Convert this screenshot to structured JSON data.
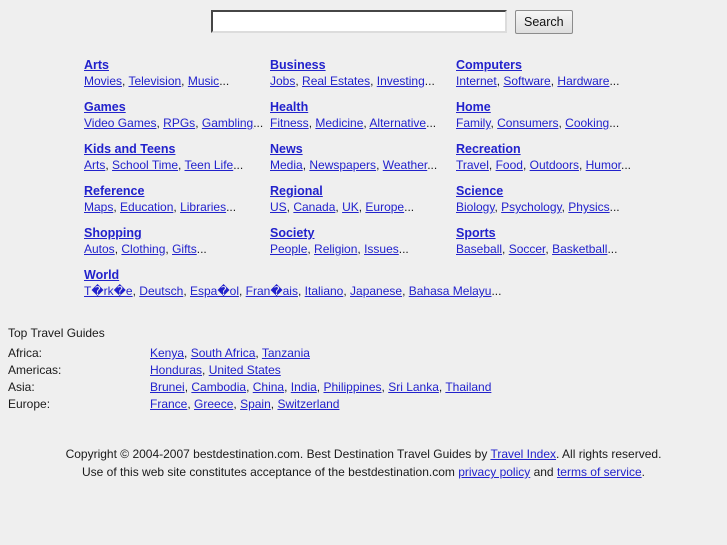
{
  "search": {
    "value": "",
    "placeholder": "",
    "button_label": "Search"
  },
  "categories": [
    {
      "title": "Arts",
      "subs": [
        "Movies",
        "Television",
        "Music"
      ],
      "ellipsis": "..."
    },
    {
      "title": "Business",
      "subs": [
        "Jobs",
        "Real Estates",
        "Investing"
      ],
      "ellipsis": "..."
    },
    {
      "title": "Computers",
      "subs": [
        "Internet",
        "Software",
        "Hardware"
      ],
      "ellipsis": "..."
    },
    {
      "title": "Games",
      "subs": [
        "Video Games",
        "RPGs",
        "Gambling"
      ],
      "ellipsis": "..."
    },
    {
      "title": "Health",
      "subs": [
        "Fitness",
        "Medicine",
        "Alternative"
      ],
      "ellipsis": "..."
    },
    {
      "title": "Home",
      "subs": [
        "Family",
        "Consumers",
        "Cooking"
      ],
      "ellipsis": "..."
    },
    {
      "title": "Kids and Teens",
      "subs": [
        "Arts",
        "School Time",
        "Teen Life"
      ],
      "ellipsis": "..."
    },
    {
      "title": "News",
      "subs": [
        "Media",
        "Newspapers",
        "Weather"
      ],
      "ellipsis": "..."
    },
    {
      "title": "Recreation",
      "subs": [
        "Travel",
        "Food",
        "Outdoors",
        "Humor"
      ],
      "ellipsis": "..."
    },
    {
      "title": "Reference",
      "subs": [
        "Maps",
        "Education",
        "Libraries"
      ],
      "ellipsis": "..."
    },
    {
      "title": "Regional",
      "subs": [
        "US",
        "Canada",
        "UK",
        "Europe"
      ],
      "ellipsis": "..."
    },
    {
      "title": "Science",
      "subs": [
        "Biology",
        "Psychology",
        "Physics"
      ],
      "ellipsis": "..."
    },
    {
      "title": "Shopping",
      "subs": [
        "Autos",
        "Clothing",
        "Gifts"
      ],
      "ellipsis": "..."
    },
    {
      "title": "Society",
      "subs": [
        "People",
        "Religion",
        "Issues"
      ],
      "ellipsis": "..."
    },
    {
      "title": "Sports",
      "subs": [
        "Baseball",
        "Soccer",
        "Basketball"
      ],
      "ellipsis": "..."
    },
    {
      "title": "World",
      "subs": [
        "T�rk�e",
        "Deutsch",
        "Espa�ol",
        "Fran�ais",
        "Italiano",
        "Japanese",
        "Bahasa Melayu"
      ],
      "ellipsis": "..."
    }
  ],
  "guides": {
    "title": "Top Travel Guides",
    "rows": [
      {
        "label": "Africa:",
        "links": [
          "Kenya",
          "South Africa",
          "Tanzania"
        ]
      },
      {
        "label": "Americas:",
        "links": [
          "Honduras",
          "United States"
        ]
      },
      {
        "label": "Asia:",
        "links": [
          "Brunei",
          "Cambodia",
          "China",
          "India",
          "Philippines",
          "Sri Lanka",
          "Thailand"
        ]
      },
      {
        "label": "Europe:",
        "links": [
          "France",
          "Greece",
          "Spain",
          "Switzerland"
        ]
      }
    ]
  },
  "footer": {
    "line1_before": "Copyright © 2004-2007 bestdestination.com. Best Destination Travel Guides by ",
    "line1_link": "Travel Index",
    "line1_after": ". All rights reserved.",
    "line2_before": "Use of this web site constitutes acceptance of the bestdestination.com ",
    "line2_link1": "privacy policy",
    "line2_middle": " and ",
    "line2_link2": "terms of service",
    "line2_after": "."
  },
  "colors": {
    "background": "#efefef",
    "link": "#2222cc",
    "text": "#1a1a1a"
  }
}
